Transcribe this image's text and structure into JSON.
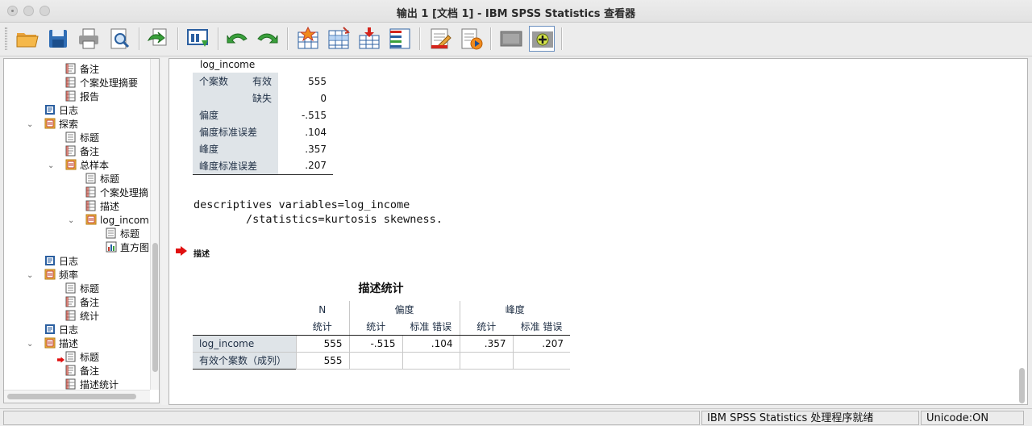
{
  "window": {
    "title": "输出 1 [文档 1] - IBM SPSS Statistics 查看器"
  },
  "toolbar": {
    "icons": [
      "open-folder-icon",
      "save-icon",
      "print-icon",
      "print-preview-icon",
      "export-icon",
      "recall-dialog-icon",
      "undo-icon",
      "redo-icon",
      "goto-data-icon",
      "goto-case-icon",
      "goto-variable-icon",
      "variables-icon",
      "designate-window-icon",
      "run-script-icon",
      "show-hide-icon",
      "promote-icon"
    ]
  },
  "nav": {
    "items": [
      {
        "label": "备注",
        "icon": "notes-icon"
      },
      {
        "label": "个案处理摘要",
        "icon": "table-icon"
      },
      {
        "label": "报告",
        "icon": "table-icon"
      },
      {
        "label": "日志",
        "icon": "log-icon"
      },
      {
        "label": "探索",
        "icon": "output-group-icon"
      },
      {
        "label": "标题",
        "icon": "title-icon"
      },
      {
        "label": "备注",
        "icon": "notes-icon"
      },
      {
        "label": "总样本",
        "icon": "output-group-icon"
      },
      {
        "label": "标题",
        "icon": "title-icon"
      },
      {
        "label": "个案处理摘",
        "icon": "table-icon"
      },
      {
        "label": "描述",
        "icon": "table-icon"
      },
      {
        "label": "log_incom",
        "icon": "output-group-icon"
      },
      {
        "label": "标题",
        "icon": "title-icon"
      },
      {
        "label": "直方图",
        "icon": "chart-icon"
      },
      {
        "label": "日志",
        "icon": "log-icon"
      },
      {
        "label": "频率",
        "icon": "output-group-icon"
      },
      {
        "label": "标题",
        "icon": "title-icon"
      },
      {
        "label": "备注",
        "icon": "notes-icon"
      },
      {
        "label": "统计",
        "icon": "table-icon"
      },
      {
        "label": "日志",
        "icon": "log-icon"
      },
      {
        "label": "描述",
        "icon": "output-group-icon"
      },
      {
        "label": "标题",
        "icon": "title-icon"
      },
      {
        "label": "备注",
        "icon": "notes-icon"
      },
      {
        "label": "描述统计",
        "icon": "table-icon"
      }
    ]
  },
  "stats_table": {
    "var_title": "log_income",
    "rows": [
      {
        "label1": "个案数",
        "label2": "有效",
        "value": "555"
      },
      {
        "label1": "",
        "label2": "缺失",
        "value": "0"
      },
      {
        "label1": "偏度",
        "label2": "",
        "value": "-.515"
      },
      {
        "label1": "偏度标准误差",
        "label2": "",
        "value": ".104"
      },
      {
        "label1": "峰度",
        "label2": "",
        "value": ".357"
      },
      {
        "label1": "峰度标准误差",
        "label2": "",
        "value": ".207"
      }
    ]
  },
  "syntax": {
    "line1": "descriptives variables=log_income",
    "line2": "        /statistics=kurtosis skewness."
  },
  "heading": {
    "label": "描述"
  },
  "desc_table": {
    "title": "描述统计",
    "header_n": "N",
    "header_skew": "偏度",
    "header_kurt": "峰度",
    "sub_stat": "统计",
    "sub_se": "标准 错误",
    "rows": [
      {
        "label": "log_income",
        "n": "555",
        "skew": "-.515",
        "skew_se": ".104",
        "kurt": ".357",
        "kurt_se": ".207"
      },
      {
        "label": "有效个案数（成列）",
        "n": "555",
        "skew": "",
        "skew_se": "",
        "kurt": "",
        "kurt_se": ""
      }
    ]
  },
  "status": {
    "processor": "IBM SPSS Statistics 处理程序就绪",
    "unicode": "Unicode:ON"
  },
  "colors": {
    "shade": "#dfe4e8",
    "accent_red": "#e01010"
  }
}
